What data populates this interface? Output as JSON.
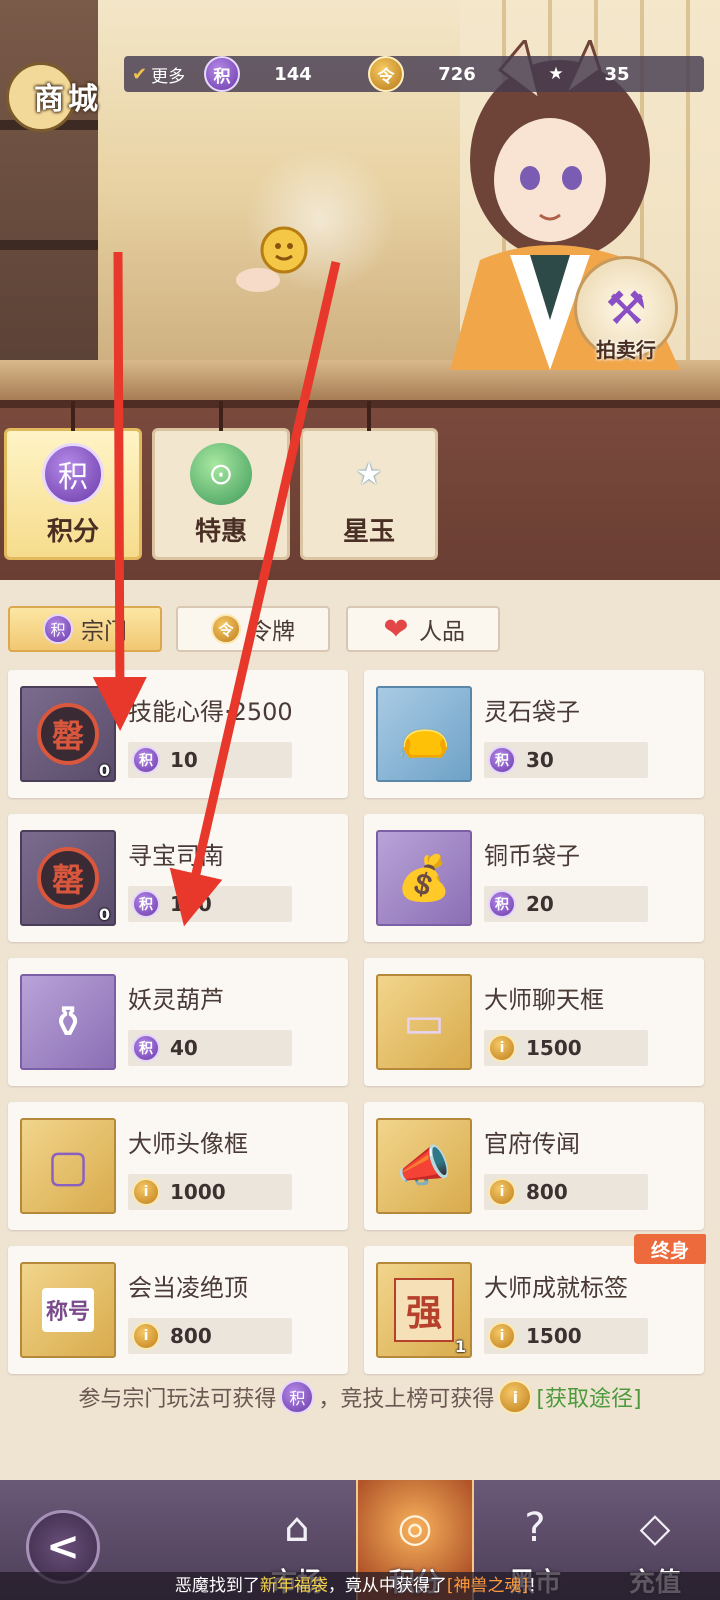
{
  "header": {
    "title": "商城",
    "more_label": "更多",
    "currencies": [
      {
        "icon": "points-icon",
        "glyph": "积",
        "value": "144"
      },
      {
        "icon": "token-icon",
        "glyph": "令",
        "value": "726"
      },
      {
        "icon": "star-jade-icon",
        "glyph": "★",
        "value": "35"
      }
    ],
    "auction_label": "拍卖行"
  },
  "categories": [
    {
      "label": "积分",
      "glyph": "积",
      "icon": "points-icon",
      "active": true
    },
    {
      "label": "特惠",
      "glyph": "⊙",
      "icon": "dragon-icon",
      "active": false
    },
    {
      "label": "星玉",
      "glyph": "★",
      "icon": "star-jade-icon",
      "active": false
    }
  ],
  "subtabs": [
    {
      "label": "宗门",
      "glyph": "积",
      "active": true
    },
    {
      "label": "令牌",
      "glyph": "令",
      "active": false
    },
    {
      "label": "人品",
      "glyph": "❤",
      "active": false
    }
  ],
  "items": [
    {
      "name": "技能心得·2500",
      "price": "10",
      "currency": "积",
      "thumb_glyph": "罄",
      "count": "0"
    },
    {
      "name": "灵石袋子",
      "price": "30",
      "currency": "积",
      "thumb_glyph": "👝",
      "count": ""
    },
    {
      "name": "寻宝司南",
      "price": "150",
      "currency": "积",
      "thumb_glyph": "罄",
      "count": "0"
    },
    {
      "name": "铜币袋子",
      "price": "20",
      "currency": "积",
      "thumb_glyph": "💰",
      "count": ""
    },
    {
      "name": "妖灵葫芦",
      "price": "40",
      "currency": "积",
      "thumb_glyph": "⚱",
      "count": ""
    },
    {
      "name": "大师聊天框",
      "price": "1500",
      "currency": "i",
      "thumb_glyph": "▭",
      "count": ""
    },
    {
      "name": "大师头像框",
      "price": "1000",
      "currency": "i",
      "thumb_glyph": "▢",
      "count": ""
    },
    {
      "name": "官府传闻",
      "price": "800",
      "currency": "i",
      "thumb_glyph": "📣",
      "count": ""
    },
    {
      "name": "会当凌绝顶",
      "price": "800",
      "currency": "i",
      "thumb_glyph": "称号",
      "count": ""
    },
    {
      "name": "大师成就标签",
      "price": "1500",
      "currency": "i",
      "thumb_glyph": "强",
      "count": "1",
      "tag": "终身"
    }
  ],
  "hint": {
    "part1": "参与宗门玩法可获得",
    "part2": "，竞技上榜可获得",
    "link": "[获取途径]"
  },
  "nav": {
    "items": [
      {
        "label": "市场",
        "glyph": "⌂",
        "active": false
      },
      {
        "label": "积分",
        "glyph": "◎",
        "active": true
      },
      {
        "label": "黑市",
        "glyph": "?",
        "active": false
      },
      {
        "label": "充值",
        "glyph": "◇",
        "active": false
      }
    ]
  },
  "ticker": {
    "part1": "恶魔找到了",
    "highlight1": "新年福袋",
    "part2": "，竟从中获得了",
    "highlight2": "[神兽之魂]",
    "part3": "！"
  },
  "colors": {
    "arrow": "#e8382c",
    "accent_orange": "#ec6a3b",
    "link_green": "#4d9a3d"
  }
}
